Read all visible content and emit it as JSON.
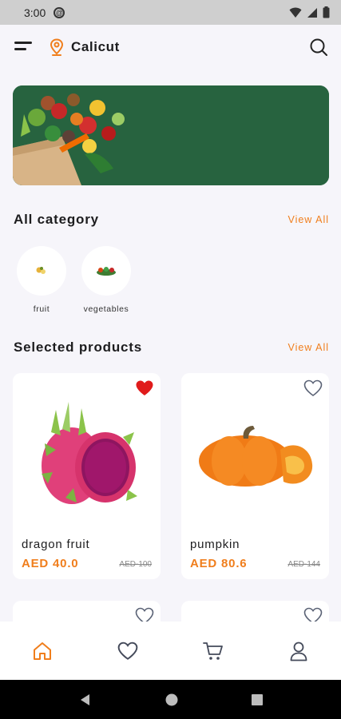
{
  "status_bar": {
    "time": "3:00"
  },
  "header": {
    "location": "Calicut"
  },
  "sections": {
    "categories_title": "All category",
    "categories_view_all": "View All",
    "products_title": "Selected products",
    "products_view_all": "View All"
  },
  "categories": [
    {
      "label": "fruit"
    },
    {
      "label": "vegetables"
    }
  ],
  "products": [
    {
      "name": "dragon fruit",
      "price": "AED 40.0",
      "old_price": "AED-100",
      "favorited": true
    },
    {
      "name": "pumpkin",
      "price": "AED 80.6",
      "old_price": "AED-144",
      "favorited": false
    }
  ],
  "colors": {
    "accent": "#f07e1c",
    "favorite": "#e01b1b",
    "banner": "#26613e"
  }
}
